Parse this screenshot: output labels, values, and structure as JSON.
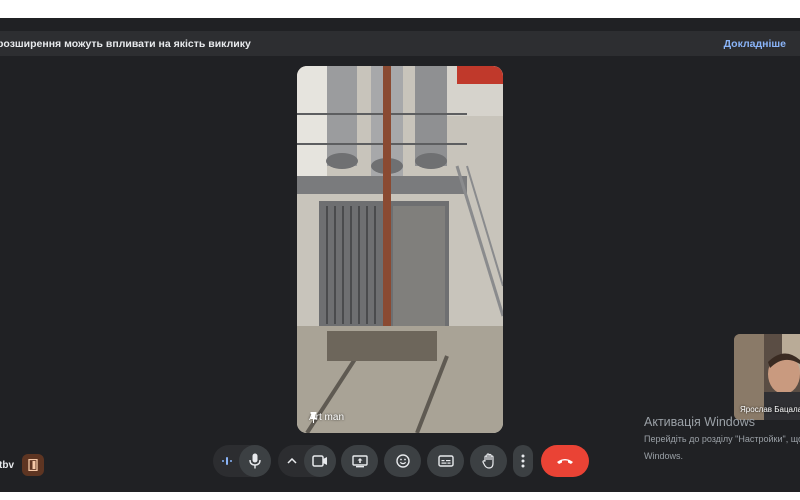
{
  "banner": {
    "text": "розширення можуть впливати на якість виклику",
    "link": "Докладніше"
  },
  "main_tile": {
    "participant_name": "Art man",
    "pinned": true
  },
  "self_view": {
    "participant_name": "Ярослав Бацала"
  },
  "activation_watermark": {
    "title": "Активація Windows",
    "line1": "Перейдіть до розділу \"Настройки\", щоб",
    "line2": "Windows."
  },
  "meeting": {
    "code": "tbv"
  },
  "controls": {
    "buttons": [
      "captions-audio-icon",
      "microphone-icon",
      "chevron-up-icon",
      "camera-icon",
      "present-screen-icon",
      "emoji-icon",
      "captions-icon",
      "raise-hand-icon",
      "more-options-icon",
      "end-call-icon"
    ],
    "end_call_color": "#ea4335"
  },
  "progress": {
    "fraction": 0.14
  },
  "colors": {
    "background": "#202124",
    "banner": "#2d2e31",
    "link": "#8ab4f8",
    "button": "#3c4043"
  }
}
